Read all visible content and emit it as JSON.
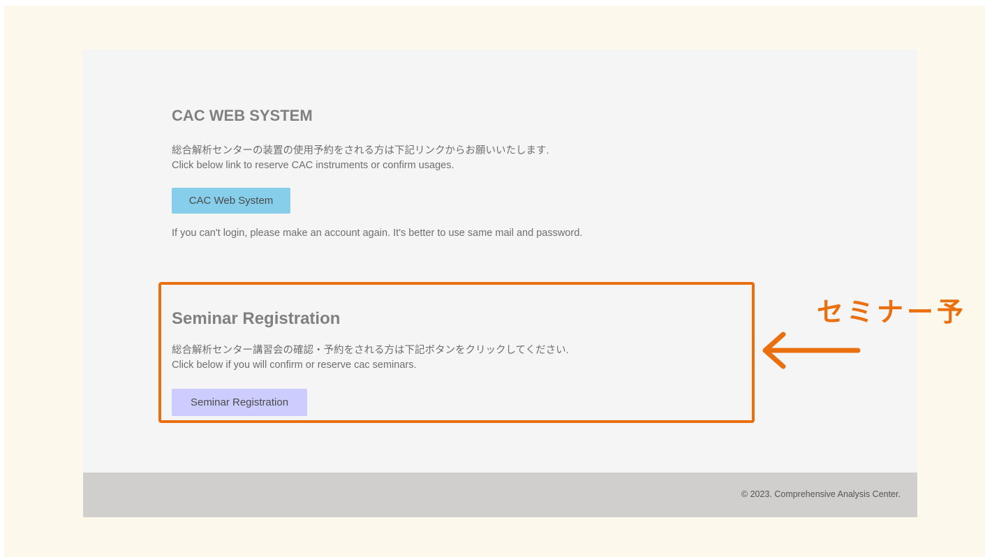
{
  "cac": {
    "title": "CAC WEB SYSTEM",
    "desc_jp": "総合解析センターの装置の使用予約をされる方は下記リンクからお願いいたします.",
    "desc_en": "Click below link to reserve CAC instruments or confirm usages.",
    "button_label": "CAC Web System",
    "note": "If you can't login, please make an account again. It's better to use same mail and password."
  },
  "seminar": {
    "title": "Seminar Registration",
    "desc_jp": "総合解析センター講習会の確認・予約をされる方は下記ボタンをクリックしてください.",
    "desc_en": "Click below if you will confirm or reserve cac seminars.",
    "button_label": "Seminar Registration"
  },
  "footer": {
    "copyright": "© 2023. Comprehensive Analysis Center."
  },
  "annotation": {
    "label": "セミナー予",
    "color": "#ea6f0f",
    "arrow_icon": "left-arrow-icon"
  },
  "colors": {
    "page_background": "#f5f5f5",
    "frame_background": "#fdf8ec",
    "cac_button": "#87ceeb",
    "seminar_button": "#ccccff",
    "footer_background": "#d1cfce"
  }
}
